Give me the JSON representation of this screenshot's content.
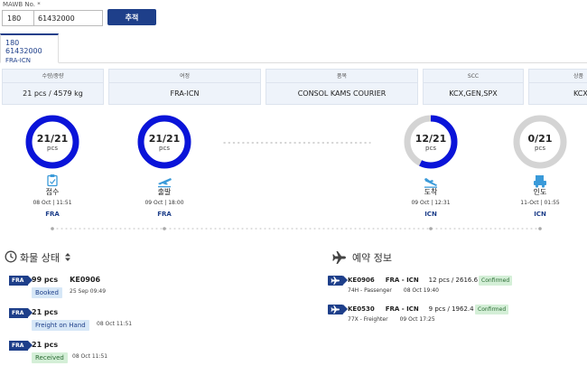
{
  "search": {
    "label": "MAWB No. *",
    "prefix": "180",
    "number": "61432000",
    "button": "추적"
  },
  "tab": {
    "line1": "180 61432000",
    "line2": "FRA-ICN"
  },
  "summary": [
    {
      "header": "수량/중량",
      "value": "21 pcs / 4579 kg"
    },
    {
      "header": "여정",
      "value": "FRA-ICN"
    },
    {
      "header": "품목",
      "value": "CONSOL KAMS COURIER"
    },
    {
      "header": "SCC",
      "value": "KCX,GEN,SPX"
    },
    {
      "header": "상품",
      "value": "KCX"
    }
  ],
  "milestones": [
    {
      "label": "접수",
      "date": "08 Oct | 11:51",
      "loc": "FRA",
      "count": "21/21",
      "unit": "pcs",
      "progress": 1.0,
      "icon": "clipboard-icon"
    },
    {
      "label": "출발",
      "date": "09 Oct | 18:00",
      "loc": "FRA",
      "count": "21/21",
      "unit": "pcs",
      "progress": 1.0,
      "icon": "plane-departure-icon"
    },
    {
      "label": "도착",
      "date": "09 Oct | 12:31",
      "loc": "ICN",
      "count": "12/21",
      "unit": "pcs",
      "progress": 0.5714,
      "icon": "plane-arrival-icon"
    },
    {
      "label": "인도",
      "date": "11-Oct | 01:55",
      "loc": "ICN",
      "count": "0/21",
      "unit": "pcs",
      "progress": 0.0,
      "icon": "truck-delivery-icon"
    }
  ],
  "status_section": {
    "title": "화물 상태"
  },
  "status_items": [
    {
      "station": "FRA",
      "pcs": "99 pcs",
      "flight": "KE0906",
      "chip": "Booked",
      "chip_color": "blue",
      "date": "25 Sep 09:49"
    },
    {
      "station": "FRA",
      "pcs": "21 pcs",
      "flight": "",
      "chip": "Freight on Hand",
      "chip_color": "blue",
      "date": "08 Oct 11:51"
    },
    {
      "station": "FRA",
      "pcs": "21 pcs",
      "flight": "",
      "chip": "Received",
      "chip_color": "green",
      "date": "08 Oct 11:51"
    }
  ],
  "booking_section": {
    "title": "예약 정보"
  },
  "booking_items": [
    {
      "flight": "KE0906",
      "route": "FRA - ICN",
      "weight": "12 pcs / 2616.6 kg",
      "status": "Confirmed",
      "aircraft": "74H - Passenger",
      "date": "08 Oct 19:40"
    },
    {
      "flight": "KE0530",
      "route": "FRA - ICN",
      "weight": "9 pcs / 1962.4 kg",
      "status": "Confirmed",
      "aircraft": "77X - Freighter",
      "date": "09 Oct 17:25"
    }
  ],
  "colors": {
    "accent": "#1e3f8a",
    "ring": "#0a14d9",
    "ring_track": "#d4d4d4",
    "icon": "#3a9ad9"
  }
}
